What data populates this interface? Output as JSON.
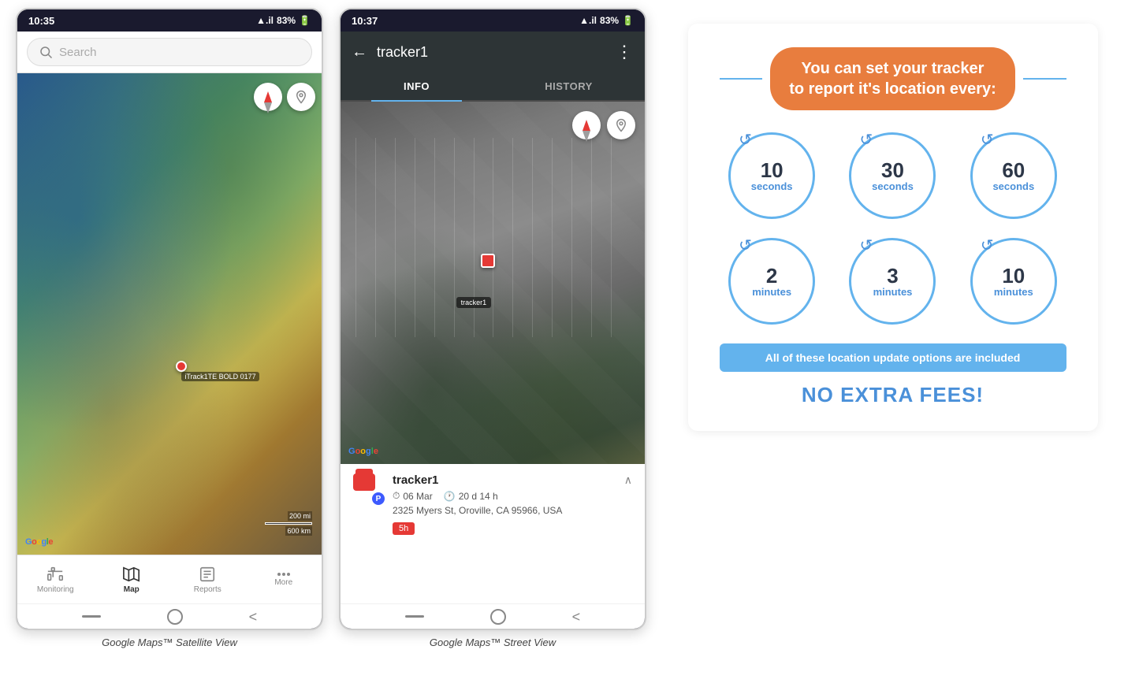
{
  "phone1": {
    "status_time": "10:35",
    "status_signal": "▲.il",
    "status_battery": "83%",
    "search_placeholder": "Search",
    "map_type": "satellite",
    "device_label": "iTrack1TE BOLD 0177",
    "scale_text1": "200 mi",
    "scale_text2": "600 km",
    "google_text": "Google",
    "nav_items": [
      {
        "label": "Monitoring",
        "icon": "bus"
      },
      {
        "label": "Map",
        "icon": "map",
        "active": true
      },
      {
        "label": "Reports",
        "icon": "reports"
      },
      {
        "label": "More",
        "icon": "more"
      }
    ],
    "caption": "Google Maps™ Satellite View"
  },
  "phone2": {
    "status_time": "10:37",
    "status_signal": "▲.il",
    "status_battery": "83%",
    "tracker_name": "tracker1",
    "tab_info": "INFO",
    "tab_history": "HISTORY",
    "map_type": "street",
    "map_label": "tracker1",
    "google_text": "Google",
    "tracker_date": "06 Mar",
    "tracker_duration": "20 d 14 h",
    "tracker_address": "2325 Myers St, Oroville, CA 95966, USA",
    "tracker_badge": "5h",
    "caption": "Google Maps™ Street View"
  },
  "info_panel": {
    "headline_line1": "You can set your tracker",
    "headline_line2": "to report it's location every:",
    "circles": [
      {
        "num": "10",
        "unit": "seconds"
      },
      {
        "num": "30",
        "unit": "seconds"
      },
      {
        "num": "60",
        "unit": "seconds"
      },
      {
        "num": "2",
        "unit": "minutes"
      },
      {
        "num": "3",
        "unit": "minutes"
      },
      {
        "num": "10",
        "unit": "minutes"
      }
    ],
    "banner_text": "All of these location update options are included",
    "no_fees_text": "NO EXTRA FEES!"
  }
}
